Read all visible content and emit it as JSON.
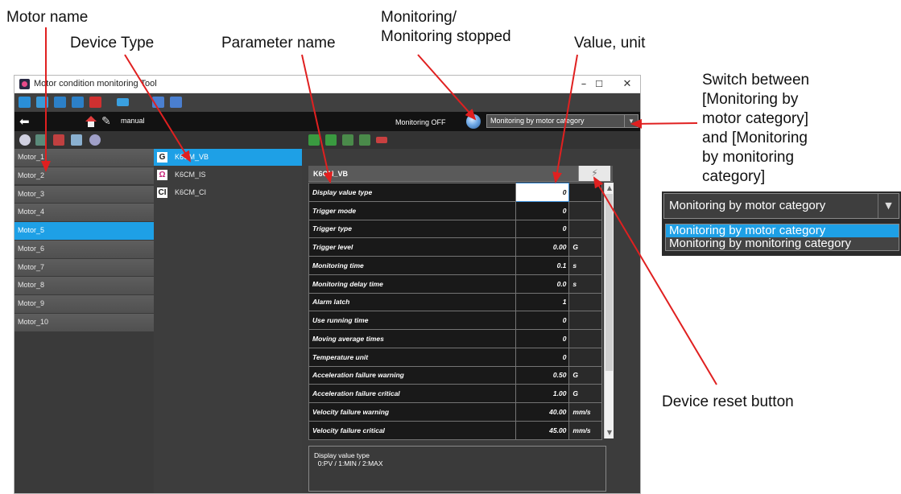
{
  "callouts": {
    "motor_name": "Motor name",
    "device_type": "Device Type",
    "parameter_name": "Parameter name",
    "monitoring": "Monitoring/\nMonitoring stopped",
    "value_unit": "Value, unit",
    "switch": "Switch between\n[Monitoring by\nmotor category]\nand [Monitoring\nby monitoring\ncategory]",
    "device_reset": "Device reset button"
  },
  "window": {
    "title": "Motor condition monitoring Tool",
    "minimize": "–",
    "maximize": "☐",
    "close": "✕"
  },
  "toolbar2": {
    "mode_label": "manual",
    "monitoring_status": "Monitoring OFF",
    "monitoring_select": "Monitoring by motor category"
  },
  "motors": [
    {
      "name": "Motor_1",
      "selected": false
    },
    {
      "name": "Motor_2",
      "selected": false
    },
    {
      "name": "Motor_3",
      "selected": false
    },
    {
      "name": "Motor_4",
      "selected": false
    },
    {
      "name": "Motor_5",
      "selected": true
    },
    {
      "name": "Motor_6",
      "selected": false
    },
    {
      "name": "Motor_7",
      "selected": false
    },
    {
      "name": "Motor_8",
      "selected": false
    },
    {
      "name": "Motor_9",
      "selected": false
    },
    {
      "name": "Motor_10",
      "selected": false
    }
  ],
  "devices": [
    {
      "badge": "G",
      "badge_color": "#1a1a1a",
      "name": "K6CM_VB",
      "selected": true
    },
    {
      "badge": "Ω",
      "badge_color": "#c8267a",
      "name": "K6CM_IS",
      "selected": false
    },
    {
      "badge": "CI",
      "badge_color": "#1a1a1a",
      "name": "K6CM_CI",
      "selected": false
    }
  ],
  "table": {
    "header": "K6CM_VB",
    "reset_icon": "⚡",
    "rows": [
      {
        "name": "Display value type",
        "value": "0",
        "unit": ""
      },
      {
        "name": "Trigger mode",
        "value": "0",
        "unit": ""
      },
      {
        "name": "Trigger type",
        "value": "0",
        "unit": ""
      },
      {
        "name": "Trigger level",
        "value": "0.00",
        "unit": "G"
      },
      {
        "name": "Monitoring time",
        "value": "0.1",
        "unit": "s"
      },
      {
        "name": "Monitoring delay time",
        "value": "0.0",
        "unit": "s"
      },
      {
        "name": "Alarm latch",
        "value": "1",
        "unit": ""
      },
      {
        "name": "Use running time",
        "value": "0",
        "unit": ""
      },
      {
        "name": "Moving average times",
        "value": "0",
        "unit": ""
      },
      {
        "name": "Temperature unit",
        "value": "0",
        "unit": ""
      },
      {
        "name": "Acceleration failure warning",
        "value": "0.50",
        "unit": "G"
      },
      {
        "name": "Acceleration failure critical",
        "value": "1.00",
        "unit": "G"
      },
      {
        "name": "Velocity failure warning",
        "value": "40.00",
        "unit": "mm/s"
      },
      {
        "name": "Velocity failure critical",
        "value": "45.00",
        "unit": "mm/s"
      }
    ]
  },
  "description": "Display value type\n  0:PV / 1:MIN / 2:MAX",
  "inset": {
    "selected": "Monitoring by motor category",
    "options": [
      "Monitoring by motor category",
      "Monitoring by monitoring category"
    ]
  },
  "colors": {
    "accent": "#1ea0e6",
    "arrow": "#e02020"
  }
}
